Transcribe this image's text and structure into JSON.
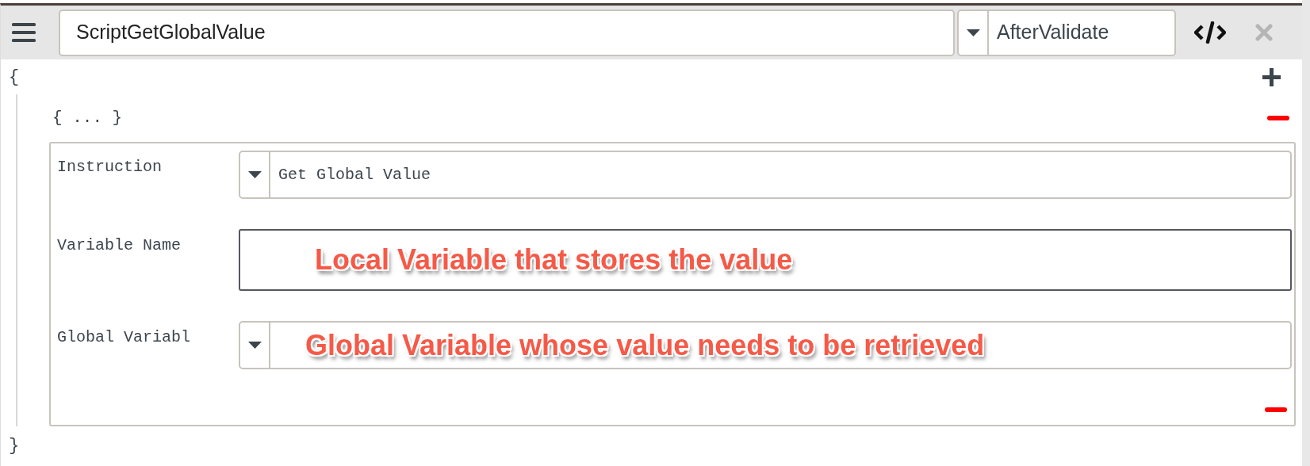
{
  "header": {
    "script_name": "ScriptGetGlobalValue",
    "event": "AfterValidate"
  },
  "body": {
    "open_brace": "{",
    "collapsed_block": "{ ... }",
    "close_brace": "}"
  },
  "fields": [
    {
      "kind": "dropdown",
      "label": "Instruction",
      "value": "Get Global Value"
    },
    {
      "kind": "text",
      "label": "Variable Name",
      "annotation": "Local Variable that stores the value"
    },
    {
      "kind": "dropdown",
      "label": "Global Variabl",
      "annotation": "Global Variable whose value needs to be retrieved"
    }
  ]
}
